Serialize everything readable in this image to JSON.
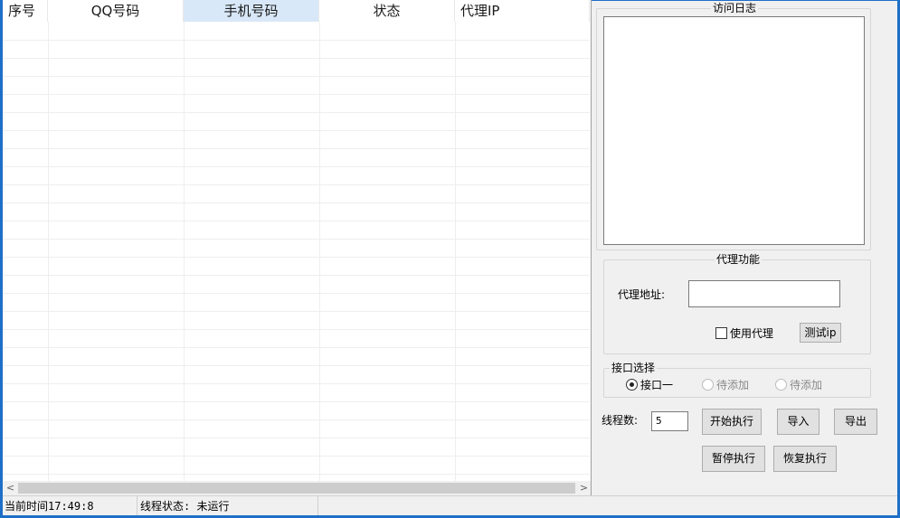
{
  "grid": {
    "columns": [
      {
        "label": "序号",
        "selected": false
      },
      {
        "label": "QQ号码",
        "selected": false
      },
      {
        "label": "手机号码",
        "selected": true
      },
      {
        "label": "状态",
        "selected": false
      },
      {
        "label": "代理IP",
        "selected": false
      }
    ],
    "rows": [],
    "scroll_left_icon": "<",
    "scroll_right_icon": ">"
  },
  "log": {
    "title": "访问日志",
    "content": ""
  },
  "proxy": {
    "title": "代理功能",
    "address_label": "代理地址:",
    "address_value": "",
    "use_proxy_label": "使用代理",
    "use_proxy_checked": false,
    "test_button": "测试ip"
  },
  "interface": {
    "title": "接口选择",
    "options": [
      {
        "label": "接口一",
        "checked": true,
        "enabled": true
      },
      {
        "label": "待添加",
        "checked": false,
        "enabled": false
      },
      {
        "label": "待添加",
        "checked": false,
        "enabled": false
      }
    ]
  },
  "threads": {
    "label": "线程数:",
    "value": "5"
  },
  "buttons": {
    "start": "开始执行",
    "import": "导入",
    "export": "导出",
    "pause": "暂停执行",
    "resume": "恢复执行"
  },
  "status": {
    "time": "当前时间17:49:8",
    "thread_state": "线程状态: 未运行"
  },
  "colors": {
    "frame": "#1e6fc7",
    "header_selected": "#d8e8f8"
  }
}
